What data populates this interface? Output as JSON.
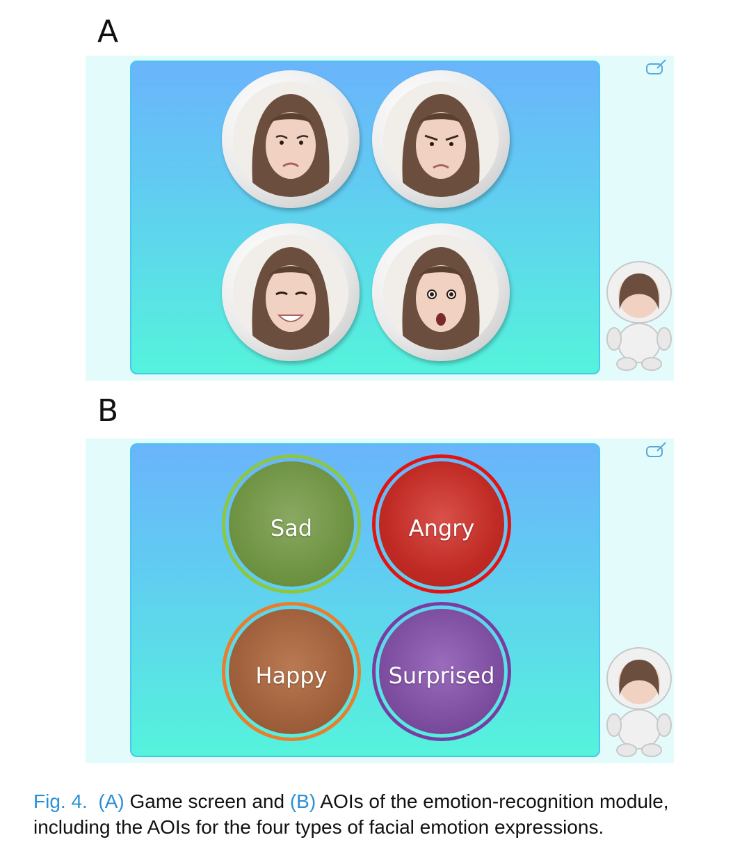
{
  "panels": [
    {
      "letter": "A",
      "faces": [
        {
          "emotion": "sad-face"
        },
        {
          "emotion": "angry-face"
        },
        {
          "emotion": "happy-face"
        },
        {
          "emotion": "surprised-face"
        }
      ]
    },
    {
      "letter": "B",
      "aois": [
        {
          "label": "Sad",
          "color": "#6fa63f",
          "ring": "#8dc640"
        },
        {
          "label": "Angry",
          "color": "#c42a26",
          "ring": "#e3140f"
        },
        {
          "label": "Happy",
          "color": "#a0603c",
          "ring": "#ea7c2a"
        },
        {
          "label": "Surprised",
          "color": "#7e4ea0",
          "ring": "#7a3ba2"
        }
      ]
    }
  ],
  "caption": {
    "fig": "Fig. 4.",
    "a_ref": "(A)",
    "a_text": "Game screen and",
    "b_ref": "(B)",
    "b_text": "AOIs of the emotion-recognition module, including the AOIs for the four types of facial emotion expressions."
  },
  "colors": {
    "board_top": "#6ab4fb",
    "board_bottom": "#55f3dc",
    "screen_bg": "#e4fbfb",
    "caption_blue": "#2a8fd4"
  }
}
